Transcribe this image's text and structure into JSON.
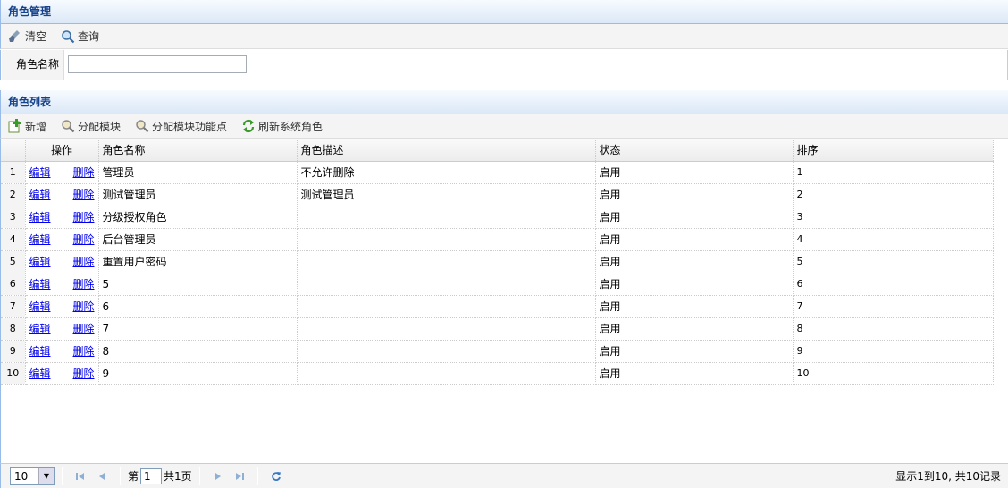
{
  "search_panel": {
    "title": "角色管理",
    "toolbar": {
      "clear_label": "清空",
      "query_label": "查询"
    },
    "role_name_label": "角色名称",
    "role_name_value": ""
  },
  "list_panel": {
    "title": "角色列表",
    "toolbar": {
      "add_label": "新增",
      "assign_module_label": "分配模块",
      "assign_function_label": "分配模块功能点",
      "refresh_label": "刷新系统角色"
    },
    "columns": [
      "操作",
      "角色名称",
      "角色描述",
      "状态",
      "排序"
    ],
    "edit_label": "编辑",
    "delete_label": "删除",
    "rows": [
      {
        "rn": "1",
        "name": "管理员",
        "desc": "不允许删除",
        "status": "启用",
        "order": "1"
      },
      {
        "rn": "2",
        "name": "测试管理员",
        "desc": "测试管理员",
        "status": "启用",
        "order": "2"
      },
      {
        "rn": "3",
        "name": "分级授权角色",
        "desc": "",
        "status": "启用",
        "order": "3"
      },
      {
        "rn": "4",
        "name": "后台管理员",
        "desc": "",
        "status": "启用",
        "order": "4"
      },
      {
        "rn": "5",
        "name": "重置用户密码",
        "desc": "",
        "status": "启用",
        "order": "5"
      },
      {
        "rn": "6",
        "name": "5",
        "desc": "",
        "status": "启用",
        "order": "6"
      },
      {
        "rn": "7",
        "name": "6",
        "desc": "",
        "status": "启用",
        "order": "7"
      },
      {
        "rn": "8",
        "name": "7",
        "desc": "",
        "status": "启用",
        "order": "8"
      },
      {
        "rn": "9",
        "name": "8",
        "desc": "",
        "status": "启用",
        "order": "9"
      },
      {
        "rn": "10",
        "name": "9",
        "desc": "",
        "status": "启用",
        "order": "10"
      }
    ]
  },
  "pager": {
    "page_size": "10",
    "page_prefix": "第",
    "current_page": "1",
    "total_pages": "共1页",
    "info": "显示1到10, 共10记录"
  },
  "icons": {
    "clear": "broom-icon",
    "query": "magnifier-icon",
    "add": "add-icon",
    "assign_module": "magnifier-icon",
    "assign_function": "magnifier-icon",
    "refresh": "refresh-arrows-icon"
  },
  "colors": {
    "header_text": "#15428b",
    "link": "#0000ee",
    "border": "#99bbe8"
  }
}
